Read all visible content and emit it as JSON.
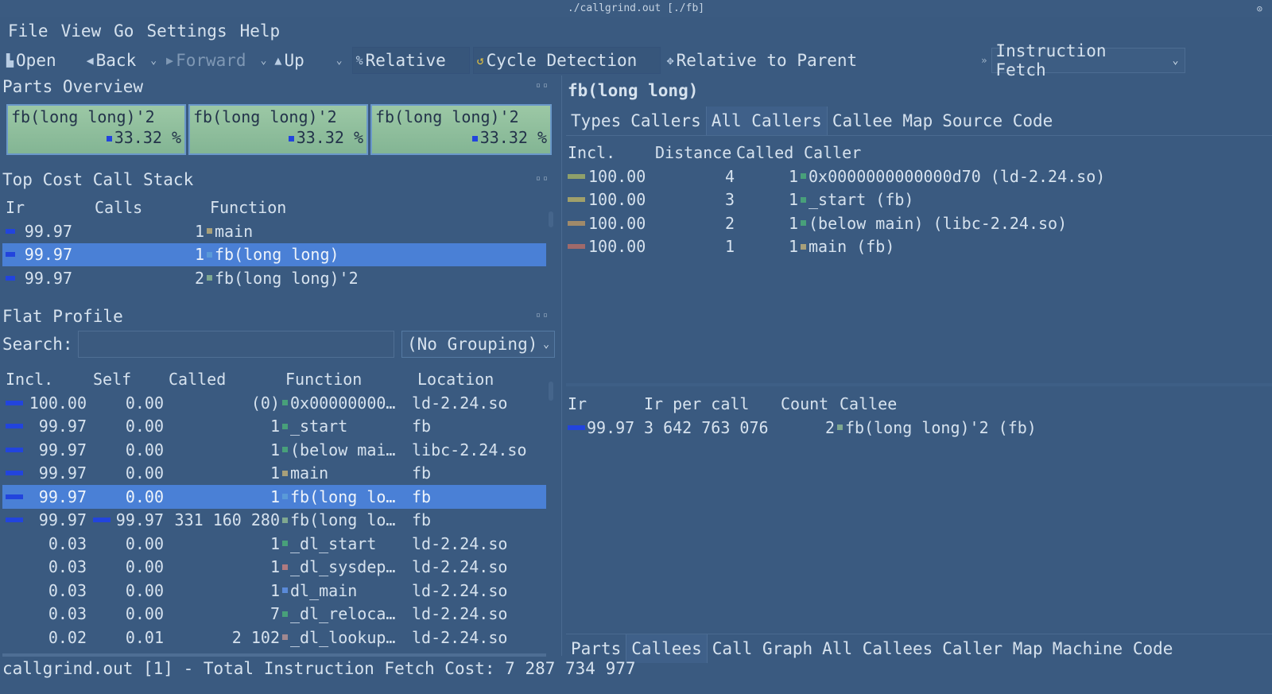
{
  "window": {
    "title": "./callgrind.out [./fb]"
  },
  "menu": [
    "File",
    "View",
    "Go",
    "Settings",
    "Help"
  ],
  "toolbar": {
    "open": "Open",
    "back": "Back",
    "forward": "Forward",
    "up": "Up",
    "relative": "Relative",
    "cycle_detection": "Cycle Detection",
    "relative_to_parent": "Relative to Parent",
    "event_type": "Instruction Fetch"
  },
  "parts_overview": {
    "title": "Parts Overview",
    "parts": [
      {
        "name": "fb(long long)'2",
        "pct": "33.32 %"
      },
      {
        "name": "fb(long long)'2",
        "pct": "33.32 %"
      },
      {
        "name": "fb(long long)'2",
        "pct": "33.32 %"
      }
    ]
  },
  "call_stack": {
    "title": "Top Cost Call Stack",
    "headers": [
      "Ir",
      "Calls",
      "Function"
    ],
    "rows": [
      {
        "ir": "99.97",
        "calls": "1",
        "fn": "main",
        "color": "#a8a07a",
        "selected": false
      },
      {
        "ir": "99.97",
        "calls": "1",
        "fn": "fb(long long)",
        "color": "#5a9ad8",
        "selected": true
      },
      {
        "ir": "99.97",
        "calls": "2",
        "fn": "fb(long long)'2",
        "color": "#7fa890",
        "selected": false
      }
    ]
  },
  "flat_profile": {
    "title": "Flat Profile",
    "search_label": "Search:",
    "search_value": "",
    "grouping": "(No Grouping)",
    "headers": [
      "Incl.",
      "Self",
      "Called",
      "Function",
      "Location"
    ],
    "rows": [
      {
        "incl": "100.00",
        "incl_bar": 1.0,
        "self": "0.00",
        "self_bar": 0,
        "called": "(0)",
        "fn": "0x00000000…",
        "loc": "ld-2.24.so",
        "color": "#48a07a",
        "selected": false
      },
      {
        "incl": "99.97",
        "incl_bar": 0.9997,
        "self": "0.00",
        "self_bar": 0,
        "called": "1",
        "fn": "_start",
        "loc": "fb",
        "color": "#48a07a",
        "selected": false
      },
      {
        "incl": "99.97",
        "incl_bar": 0.9997,
        "self": "0.00",
        "self_bar": 0,
        "called": "1",
        "fn": "(below mai…",
        "loc": "libc-2.24.so",
        "color": "#48a07a",
        "selected": false
      },
      {
        "incl": "99.97",
        "incl_bar": 0.9997,
        "self": "0.00",
        "self_bar": 0,
        "called": "1",
        "fn": "main",
        "loc": "fb",
        "color": "#a8a07a",
        "selected": false
      },
      {
        "incl": "99.97",
        "incl_bar": 0.9997,
        "self": "0.00",
        "self_bar": 0,
        "called": "1",
        "fn": "fb(long lo…",
        "loc": "fb",
        "color": "#5a9ad8",
        "selected": true
      },
      {
        "incl": "99.97",
        "incl_bar": 0.9997,
        "self": "99.97",
        "self_bar": 0.9997,
        "called": "331 160 280",
        "fn": "fb(long lo…",
        "loc": "fb",
        "color": "#7fa890",
        "selected": false
      },
      {
        "incl": "0.03",
        "incl_bar": 0,
        "self": "0.00",
        "self_bar": 0,
        "called": "1",
        "fn": "_dl_start",
        "loc": "ld-2.24.so",
        "color": "#48a07a",
        "selected": false
      },
      {
        "incl": "0.03",
        "incl_bar": 0,
        "self": "0.00",
        "self_bar": 0,
        "called": "1",
        "fn": "_dl_sysdep…",
        "loc": "ld-2.24.so",
        "color": "#b07a80",
        "selected": false
      },
      {
        "incl": "0.03",
        "incl_bar": 0,
        "self": "0.00",
        "self_bar": 0,
        "called": "1",
        "fn": "dl_main",
        "loc": "ld-2.24.so",
        "color": "#5a8ad8",
        "selected": false
      },
      {
        "incl": "0.03",
        "incl_bar": 0,
        "self": "0.00",
        "self_bar": 0,
        "called": "7",
        "fn": "_dl_reloca…",
        "loc": "ld-2.24.so",
        "color": "#48a07a",
        "selected": false
      },
      {
        "incl": "0.02",
        "incl_bar": 0,
        "self": "0.01",
        "self_bar": 0,
        "called": "2 102",
        "fn": "_dl_lookup…",
        "loc": "ld-2.24.so",
        "color": "#a08890",
        "selected": false
      }
    ]
  },
  "detail": {
    "title": "fb(long long)",
    "top_tabs": [
      "Types",
      "Callers",
      "All Callers",
      "Callee Map",
      "Source Code"
    ],
    "top_active": 2,
    "callers_headers": [
      "Incl.",
      "Distance",
      "Called",
      "Caller"
    ],
    "callers": [
      {
        "incl": "100.00",
        "dist": "4",
        "called": "1",
        "caller": "0x0000000000000d70 (ld-2.24.so)",
        "bar_color": "#8fa06a",
        "color": "#48a07a"
      },
      {
        "incl": "100.00",
        "dist": "3",
        "called": "1",
        "caller": "_start (fb)",
        "bar_color": "#a0a06a",
        "color": "#48a07a"
      },
      {
        "incl": "100.00",
        "dist": "2",
        "called": "1",
        "caller": "(below main) (libc-2.24.so)",
        "bar_color": "#a08a6a",
        "color": "#48a07a"
      },
      {
        "incl": "100.00",
        "dist": "1",
        "called": "1",
        "caller": "main (fb)",
        "bar_color": "#a06a6a",
        "color": "#a8a07a"
      }
    ],
    "callees_headers": [
      "Ir",
      "Ir per call",
      "Count",
      "Callee"
    ],
    "callees": [
      {
        "ir": "99.97",
        "per_call": "3 642 763 076",
        "count": "2",
        "callee": "fb(long long)'2 (fb)",
        "color": "#7fa890"
      }
    ],
    "bottom_tabs": [
      "Parts",
      "Callees",
      "Call Graph",
      "All Callees",
      "Caller Map",
      "Machine Code"
    ],
    "bottom_active": 1
  },
  "status": "callgrind.out [1] - Total Instruction Fetch Cost: 7 287 734 977"
}
